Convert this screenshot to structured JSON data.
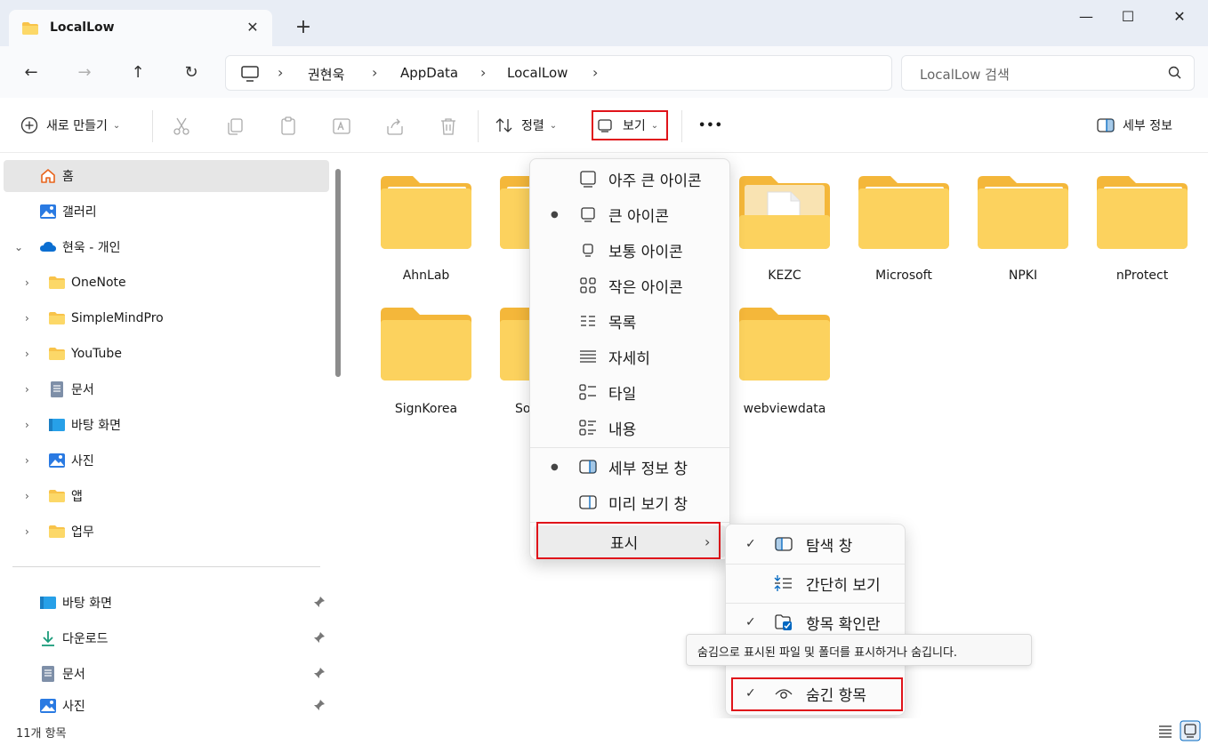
{
  "window": {
    "tab_title": "LocalLow",
    "tab_close": "✕",
    "new_tab": "+",
    "minimize": "—",
    "maximize": "☐",
    "close": "✕"
  },
  "nav": {
    "back": "←",
    "forward": "→",
    "up": "↑",
    "refresh": "↻",
    "breadcrumbs": [
      "권현욱",
      "AppData",
      "LocalLow"
    ],
    "sep": "›",
    "search_placeholder": "LocalLow 검색"
  },
  "commands": {
    "new_label": "새로 만들기",
    "sort_label": "정렬",
    "view_label": "보기",
    "more": "•••",
    "details_label": "세부 정보",
    "chevron": "⌄"
  },
  "sidebar": {
    "items": [
      {
        "label": "홈",
        "icon": "home-icon"
      },
      {
        "label": "갤러리",
        "icon": "gallery-icon"
      },
      {
        "label": "현욱 - 개인",
        "icon": "onedrive-icon"
      },
      {
        "label": "OneNote",
        "icon": "folder-icon"
      },
      {
        "label": "SimpleMindPro",
        "icon": "folder-icon"
      },
      {
        "label": "YouTube",
        "icon": "folder-icon"
      },
      {
        "label": "문서",
        "icon": "document-icon"
      },
      {
        "label": "바탕 화면",
        "icon": "desktop-icon"
      },
      {
        "label": "사진",
        "icon": "pictures-icon"
      },
      {
        "label": "앱",
        "icon": "folder-icon"
      },
      {
        "label": "업무",
        "icon": "folder-icon"
      }
    ],
    "quick_access": [
      {
        "label": "바탕 화면",
        "icon": "desktop-icon"
      },
      {
        "label": "다운로드",
        "icon": "download-icon"
      },
      {
        "label": "문서",
        "icon": "document-icon"
      },
      {
        "label": "사진",
        "icon": "pictures-icon"
      }
    ],
    "expand": "›",
    "expanded": "⌄",
    "pin": "📌"
  },
  "files": [
    "AhnLab",
    "",
    "",
    "KEZC",
    "Microsoft",
    "NPKI",
    "nProtect",
    "SignKorea",
    "So",
    "",
    "webviewdata"
  ],
  "view_menu": {
    "items": [
      {
        "label": "아주 큰 아이콘",
        "bullet": ""
      },
      {
        "label": "큰 아이콘",
        "bullet": "●"
      },
      {
        "label": "보통 아이콘",
        "bullet": ""
      },
      {
        "label": "작은 아이콘",
        "bullet": ""
      },
      {
        "label": "목록",
        "bullet": ""
      },
      {
        "label": "자세히",
        "bullet": ""
      },
      {
        "label": "타일",
        "bullet": ""
      },
      {
        "label": "내용",
        "bullet": ""
      },
      {
        "label": "세부 정보 창",
        "bullet": "●"
      },
      {
        "label": "미리 보기 창",
        "bullet": ""
      }
    ],
    "show_label": "표시",
    "show_arrow": "›"
  },
  "show_submenu": {
    "items": [
      {
        "label": "탐색 창",
        "check": "✓"
      },
      {
        "label": "간단히 보기",
        "check": ""
      },
      {
        "label": "항목 확인란",
        "check": "✓"
      },
      {
        "label": "숨긴 항목",
        "check": "✓"
      }
    ]
  },
  "tooltip": "숨김으로 표시된 파일 및 폴더를 표시하거나 숨깁니다.",
  "status": {
    "count": "11개 항목"
  },
  "colors": {
    "accent": "#0067c0",
    "folder": "#f8c34a",
    "highlight": "#e0131a"
  }
}
